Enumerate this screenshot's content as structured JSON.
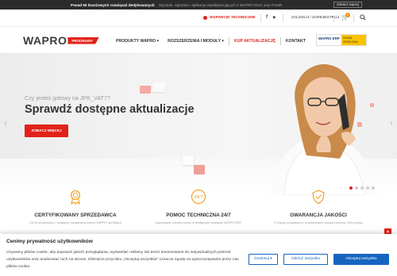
{
  "topbar": {
    "promo_strong": "Ponad 50 branżowych rozwiązań dedykowanych",
    "promo_text": "Wycinek, raportów i aplikacja współpracujących z WAPRO MAG oraz FAKIR",
    "promo_button": "Zobacz więcej"
  },
  "utility": {
    "support": "WSPARCIE TECHNICZNE",
    "facebook": "f",
    "youtube": "▶",
    "login": "ZALOGUJ / ZAREJESTRUJ",
    "cart_count": "0"
  },
  "nav": {
    "logo_text": "WAPRO",
    "logo_tag": "PROGRAMY",
    "items": [
      {
        "label": "PRODUKTY WAPRO ▾"
      },
      {
        "label": "ROZSZERZENIA I MODUŁY ▾"
      },
      {
        "label": "KUP AKTUALIZACJĘ"
      },
      {
        "label": "KONTAKT"
      }
    ],
    "erp_left": "WAPRO ERP",
    "erp_right": "NOWA ODSŁONA"
  },
  "hero": {
    "eyebrow": "Czy jesteś gotowy na JPK_VAT7?",
    "headline": "Sprawdź dostępne aktualizacje",
    "cta": "ZOBACZ WIĘCEJ",
    "prev": "‹",
    "next": "›",
    "slides_total": 5,
    "slide_active": 1
  },
  "features": [
    {
      "title": "CERTYFIKOWANY SPRZEDAWCA",
      "text": "Od 30 lat wdrażamy i rozwijamy rozwiązania Asseco WAPRO dla Małych"
    },
    {
      "title": "POMOC TECHNICZNA 24/7",
      "text": "Zapewniamy również pomoc w konfiguracji rozwiązań WAPRO ERP,"
    },
    {
      "title": "GWARANCJA JAKOŚCI",
      "text": "Z chęcią rozmawiamy z oczekiwaniami naszych klientów, żeby pomóc"
    }
  ],
  "cookie": {
    "title": "Cenimy prywatność użytkowników",
    "text": "Używamy plików cookie, aby poprawić jakość przeglądania, wyświetlać reklamy lub treści dostosowane do indywidualnych potrzeb użytkowników oraz analizować ruch na stronie. Kliknięcie przycisku „Akceptuj wszystkie” oznacza zgodę na wykorzystywanie przez nas plików cookie.",
    "customize": "Dostosuj",
    "reject": "Odrzuć wszystko",
    "accept": "Akceptuj wszystko"
  },
  "colors": {
    "brand_red": "#e2231a",
    "accent_blue": "#1565c0",
    "orange": "#f39200"
  }
}
